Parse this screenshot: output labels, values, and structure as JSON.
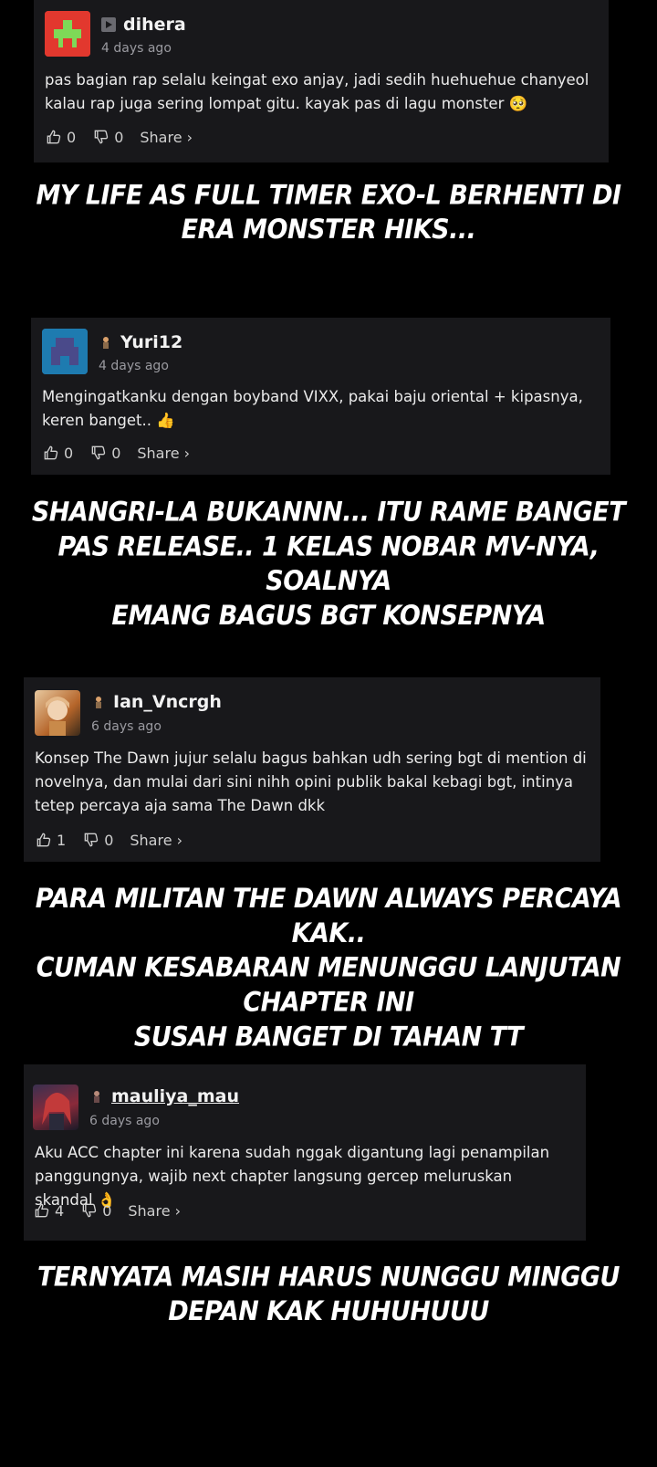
{
  "comments": [
    {
      "username": "dihera",
      "time": "4 days ago",
      "text": "pas bagian rap selalu keingat exo anjay, jadi sedih huehuehue chanyeol kalau rap juga sering lompat gitu. kayak pas di lagu monster 🥺",
      "likes": "0",
      "dislikes": "0",
      "share": "Share ›",
      "avatar_color": "#e2382e",
      "caption_lines": [
        "MY LIFE AS FULL TIMER EXO-L BERHENTI DI",
        "ERA MONSTER HIKS..."
      ]
    },
    {
      "username": "Yuri12",
      "time": "4 days ago",
      "text": "Mengingatkanku dengan boyband VIXX, pakai baju oriental + kipasnya, keren banget.. 👍",
      "likes": "0",
      "dislikes": "0",
      "share": "Share ›",
      "avatar_color": "#2a6fa0",
      "caption_lines": [
        "SHANGRI-LA BUKANNN... ITU RAME BANGET",
        "PAS RELEASE.. 1 KELAS NOBAR MV-NYA, SOALNYA",
        "EMANG BAGUS BGT KONSEPNYA"
      ]
    },
    {
      "username": "Ian_Vncrgh",
      "time": "6 days ago",
      "text": "Konsep The Dawn jujur selalu bagus bahkan udh sering bgt di mention di novelnya, dan mulai dari sini nihh opini publik bakal kebagi bgt, intinya tetep percaya aja sama The Dawn dkk",
      "likes": "1",
      "dislikes": "0",
      "share": "Share ›",
      "avatar_color": "#c7853a",
      "caption_lines": [
        "PARA MILITAN THE DAWN ALWAYS PERCAYA KAK..",
        "CUMAN KESABARAN MENUNGGU LANJUTAN CHAPTER INI",
        "SUSAH BANGET DI TAHAN TT"
      ]
    },
    {
      "username": "mauliya_mau",
      "time": "6 days ago",
      "text": "Aku ACC chapter ini karena sudah nggak digantung lagi penampilan panggungnya, wajib next chapter langsung gercep meluruskan skandal 👌",
      "likes": "4",
      "dislikes": "0",
      "share": "Share ›",
      "avatar_color": "#5a3a6a",
      "caption_lines": [
        "TERNYATA MASIH HARUS NUNGGU MINGGU",
        "DEPAN KAK HUHUHUUU"
      ]
    }
  ]
}
